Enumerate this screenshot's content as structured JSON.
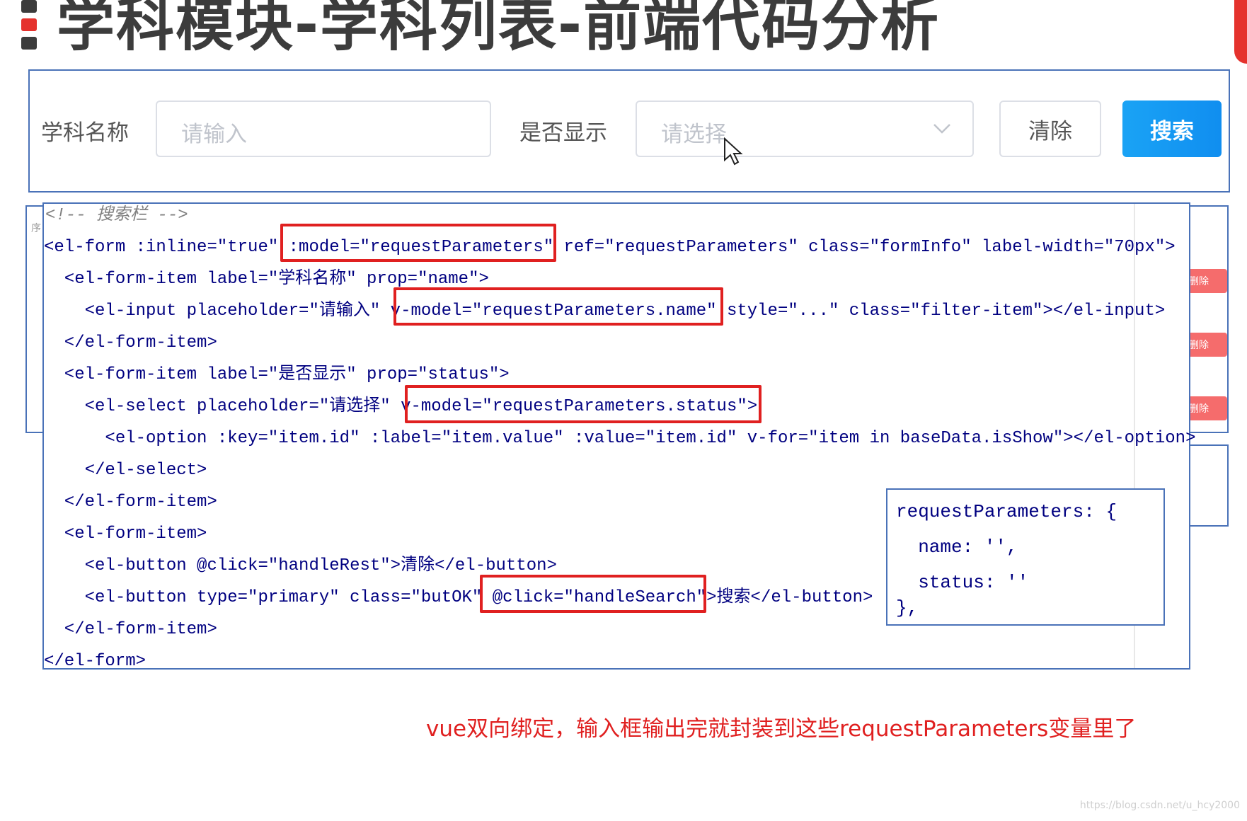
{
  "title": "学科模块-学科列表-前端代码分析",
  "colors": {
    "accent": "#1a98f0",
    "title_bar_red": "#e5322d",
    "title_bar_dark": "#3c3c3c",
    "highlight_red": "#e02020"
  },
  "form": {
    "name_label": "学科名称",
    "name_placeholder": "请输入",
    "show_label": "是否显示",
    "show_placeholder": "请选择",
    "clear_button": "清除",
    "search_button": "搜索"
  },
  "table_bg": {
    "delete_label": "删除",
    "row_marker": "序"
  },
  "code_lines": [
    "<!-- 搜索栏 -->",
    "<el-form :inline=\"true\" :model=\"requestParameters\" ref=\"requestParameters\" class=\"formInfo\" label-width=\"70px\">",
    "  <el-form-item label=\"学科名称\" prop=\"name\">",
    "    <el-input placeholder=\"请输入\" v-model=\"requestParameters.name\" style=\"...\" class=\"filter-item\"></el-input>",
    "  </el-form-item>",
    "  <el-form-item label=\"是否显示\" prop=\"status\">",
    "    <el-select placeholder=\"请选择\" v-model=\"requestParameters.status\">",
    "      <el-option :key=\"item.id\" :label=\"item.value\" :value=\"item.id\" v-for=\"item in baseData.isShow\"></el-option>",
    "    </el-select>",
    "  </el-form-item>",
    "  <el-form-item>",
    "    <el-button @click=\"handleRest\">清除</el-button>",
    "    <el-button type=\"primary\" class=\"butOK\" @click=\"handleSearch\">搜索</el-button>",
    "  </el-form-item>",
    "</el-form>"
  ],
  "side_code": [
    "requestParameters: {",
    "  name: '',",
    "  status: ''",
    "},"
  ],
  "note": "vue双向绑定，输入框输出完就封装到这些requestParameters变量里了",
  "watermark": "https://blog.csdn.net/u_hcy2000"
}
